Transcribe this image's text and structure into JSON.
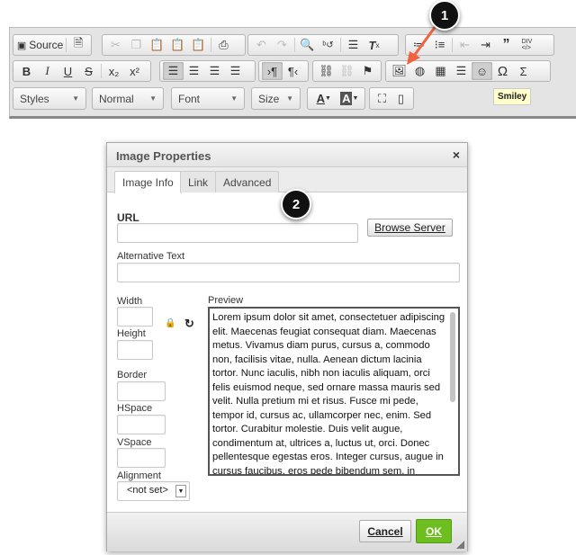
{
  "toolbar": {
    "row1": [
      {
        "group": [
          {
            "icon": "source-icon",
            "label": "Source"
          },
          {
            "icon": "templates-icon"
          }
        ]
      },
      {
        "group": [
          {
            "icon": "cut-icon"
          },
          {
            "icon": "copy-icon"
          },
          {
            "icon": "paste-icon"
          },
          {
            "icon": "paste-text-icon"
          },
          {
            "icon": "paste-word-icon"
          },
          {
            "icon": "print-icon"
          }
        ]
      },
      {
        "group": [
          {
            "icon": "undo-icon"
          },
          {
            "icon": "redo-icon"
          },
          {
            "icon": "find-icon"
          },
          {
            "icon": "replace-icon"
          },
          {
            "icon": "select-all-icon"
          },
          {
            "icon": "remove-format-icon"
          }
        ]
      },
      {
        "group": [
          {
            "icon": "numbered-list-icon"
          },
          {
            "icon": "bulleted-list-icon"
          },
          {
            "icon": "outdent-icon"
          },
          {
            "icon": "indent-icon"
          },
          {
            "icon": "blockquote-icon"
          },
          {
            "icon": "div-icon"
          }
        ]
      }
    ],
    "source_label": "Source",
    "bold": "B",
    "italic": "I",
    "underline": "U",
    "strike": "S",
    "subscript": "x₂",
    "superscript": "x²",
    "styles": "Styles",
    "format": "Normal",
    "font": "Font",
    "size": "Size",
    "tooltip": "Smiley"
  },
  "callouts": {
    "one": "1",
    "two": "2"
  },
  "dialog": {
    "title": "Image Properties",
    "close": "×",
    "tabs": [
      "Image Info",
      "Link",
      "Advanced"
    ],
    "url_label": "URL",
    "url_value": "",
    "browse_server": "Browse Server",
    "alt_label": "Alternative Text",
    "alt_value": "",
    "width_label": "Width",
    "height_label": "Height",
    "border_label": "Border",
    "hspace_label": "HSpace",
    "vspace_label": "VSpace",
    "alignment_label": "Alignment",
    "alignment_value": "<not set>",
    "preview_label": "Preview",
    "preview_text": "Lorem ipsum dolor sit amet, consectetuer adipiscing elit. Maecenas feugiat consequat diam. Maecenas metus. Vivamus diam purus, cursus a, commodo non, facilisis vitae, nulla. Aenean dictum lacinia tortor. Nunc iaculis, nibh non iaculis aliquam, orci felis euismod neque, sed ornare massa mauris sed velit. Nulla pretium mi et risus. Fusce mi pede, tempor id, cursus ac, ullamcorper nec, enim. Sed tortor. Curabitur molestie. Duis velit augue, condimentum at, ultrices a, luctus ut, orci. Donec pellentesque egestas eros. Integer cursus, augue in cursus faucibus, eros pede bibendum sem, in tempus tellus justo quis ligula. Etiam eget tortor. Vestibulum rutrum, est ut",
    "cancel": "Cancel",
    "ok": "OK"
  },
  "colors": {
    "ok_green": "#6cbf1e",
    "callout_arrow": "#f0623f"
  }
}
